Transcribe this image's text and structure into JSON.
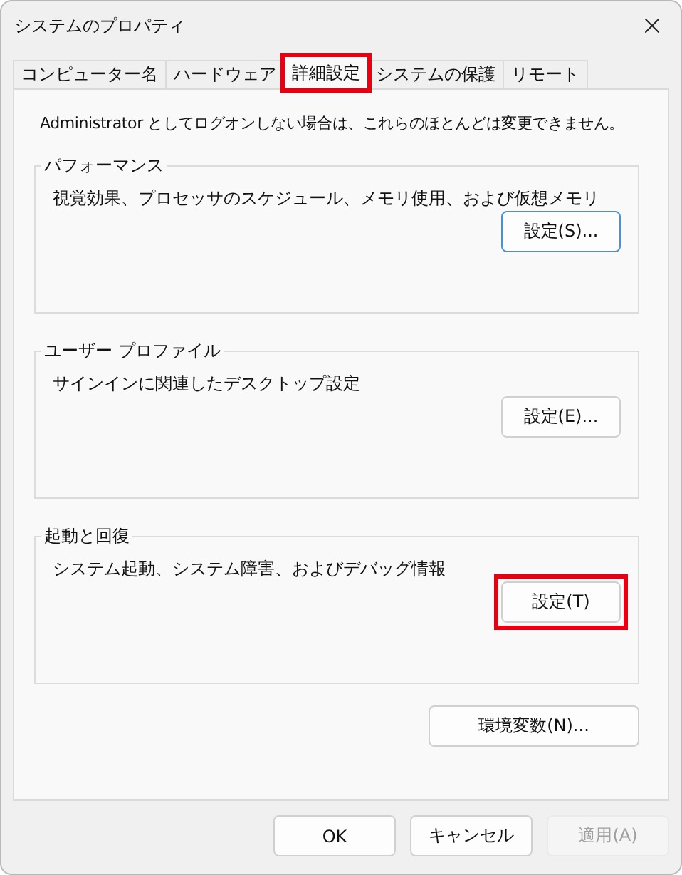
{
  "window": {
    "title": "システムのプロパティ"
  },
  "tabs": [
    {
      "label": "コンピューター名",
      "selected": false,
      "highlighted": false
    },
    {
      "label": "ハードウェア",
      "selected": false,
      "highlighted": false
    },
    {
      "label": "詳細設定",
      "selected": true,
      "highlighted": true
    },
    {
      "label": "システムの保護",
      "selected": false,
      "highlighted": false
    },
    {
      "label": "リモート",
      "selected": false,
      "highlighted": false
    }
  ],
  "notice": "Administrator としてログオンしない場合は、これらのほとんどは変更できません。",
  "groups": [
    {
      "title": "パフォーマンス",
      "description": "視覚効果、プロセッサのスケジュール、メモリ使用、および仮想メモリ",
      "button": {
        "label": "設定(S)...",
        "focused": true,
        "highlighted": false
      }
    },
    {
      "title": "ユーザー プロファイル",
      "description": "サインインに関連したデスクトップ設定",
      "button": {
        "label": "設定(E)...",
        "focused": false,
        "highlighted": false
      }
    },
    {
      "title": "起動と回復",
      "description": "システム起動、システム障害、およびデバッグ情報",
      "button": {
        "label": "設定(T)",
        "focused": false,
        "highlighted": true
      }
    }
  ],
  "env_button": {
    "label": "環境変数(N)..."
  },
  "buttons": [
    {
      "label": "OK",
      "disabled": false
    },
    {
      "label": "キャンセル",
      "disabled": false
    },
    {
      "label": "適用(A)",
      "disabled": true
    }
  ]
}
